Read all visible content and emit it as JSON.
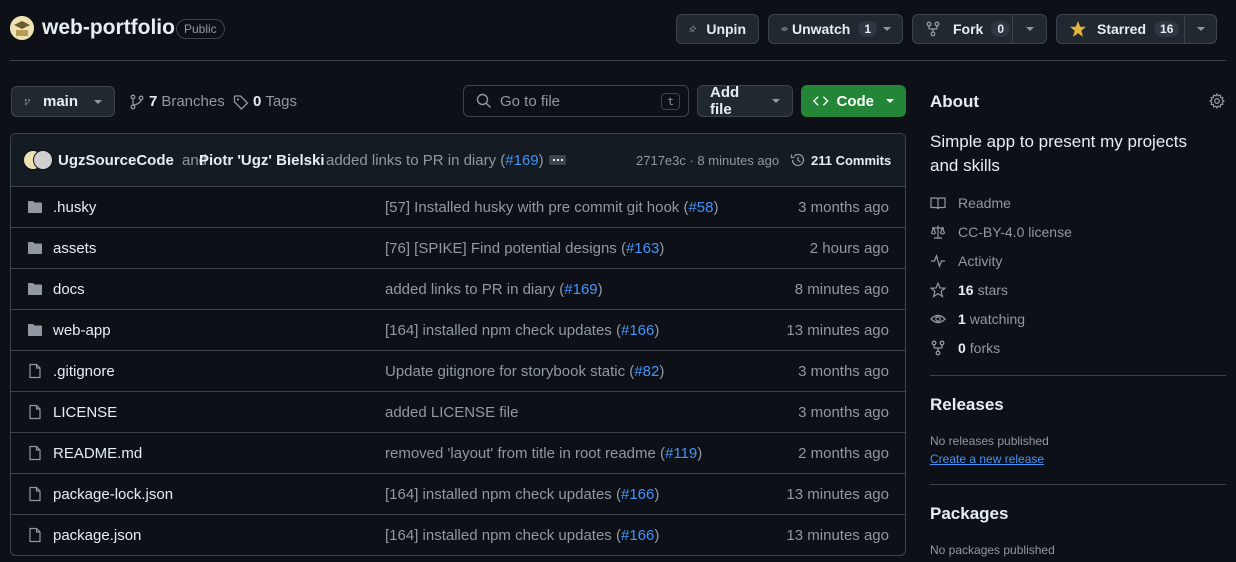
{
  "repo": {
    "name": "web-portfolio",
    "visibility": "Public"
  },
  "actions": {
    "unpin": "Unpin",
    "unwatch": "Unwatch",
    "watch_count": "1",
    "fork": "Fork",
    "fork_count": "0",
    "starred": "Starred",
    "star_count": "16"
  },
  "toolbar": {
    "branch": "main",
    "branches_count": "7",
    "branches_label": "Branches",
    "tags_count": "0",
    "tags_label": "Tags",
    "search_placeholder": "Go to file",
    "search_shortcut": "t",
    "add_file": "Add file",
    "code": "Code"
  },
  "commit": {
    "author1": "UgzSourceCode",
    "and": "and",
    "author2": "Piotr 'Ugz' Bielski",
    "message_prefix": "added links to PR in diary (",
    "pr": "#169",
    "message_suffix": ")",
    "sha_time": "2717e3c · 8 minutes ago",
    "commits": "211 Commits"
  },
  "files": [
    {
      "type": "folder",
      "name": ".husky",
      "msg_pre": "[57] Installed husky with pre commit git hook (",
      "pr": "#58",
      "msg_post": ")",
      "time": "3 months ago"
    },
    {
      "type": "folder",
      "name": "assets",
      "msg_pre": "[76] [SPIKE] Find potential designs (",
      "pr": "#163",
      "msg_post": ")",
      "time": "2 hours ago"
    },
    {
      "type": "folder",
      "name": "docs",
      "msg_pre": "added links to PR in diary (",
      "pr": "#169",
      "msg_post": ")",
      "time": "8 minutes ago"
    },
    {
      "type": "folder",
      "name": "web-app",
      "msg_pre": "[164] installed npm check updates (",
      "pr": "#166",
      "msg_post": ")",
      "time": "13 minutes ago"
    },
    {
      "type": "file",
      "name": ".gitignore",
      "msg_pre": "Update gitignore for storybook static (",
      "pr": "#82",
      "msg_post": ")",
      "time": "3 months ago"
    },
    {
      "type": "file",
      "name": "LICENSE",
      "msg_pre": "added LICENSE file",
      "pr": "",
      "msg_post": "",
      "time": "3 months ago"
    },
    {
      "type": "file",
      "name": "README.md",
      "msg_pre": "removed 'layout' from title in root readme (",
      "pr": "#119",
      "msg_post": ")",
      "time": "2 months ago"
    },
    {
      "type": "file",
      "name": "package-lock.json",
      "msg_pre": "[164] installed npm check updates (",
      "pr": "#166",
      "msg_post": ")",
      "time": "13 minutes ago"
    },
    {
      "type": "file",
      "name": "package.json",
      "msg_pre": "[164] installed npm check updates (",
      "pr": "#166",
      "msg_post": ")",
      "time": "13 minutes ago"
    }
  ],
  "about": {
    "heading": "About",
    "description": "Simple app to present my projects and skills",
    "readme": "Readme",
    "license": "CC-BY-4.0 license",
    "activity": "Activity",
    "stars_count": "16",
    "stars_label": "stars",
    "watching_count": "1",
    "watching_label": "watching",
    "forks_count": "0",
    "forks_label": "forks"
  },
  "releases": {
    "heading": "Releases",
    "none": "No releases published",
    "create": "Create a new release"
  },
  "packages": {
    "heading": "Packages",
    "none": "No packages published"
  },
  "colors": {
    "accent_green": "#238636",
    "link_blue": "#4493f8",
    "star_yellow": "#e3b341"
  }
}
